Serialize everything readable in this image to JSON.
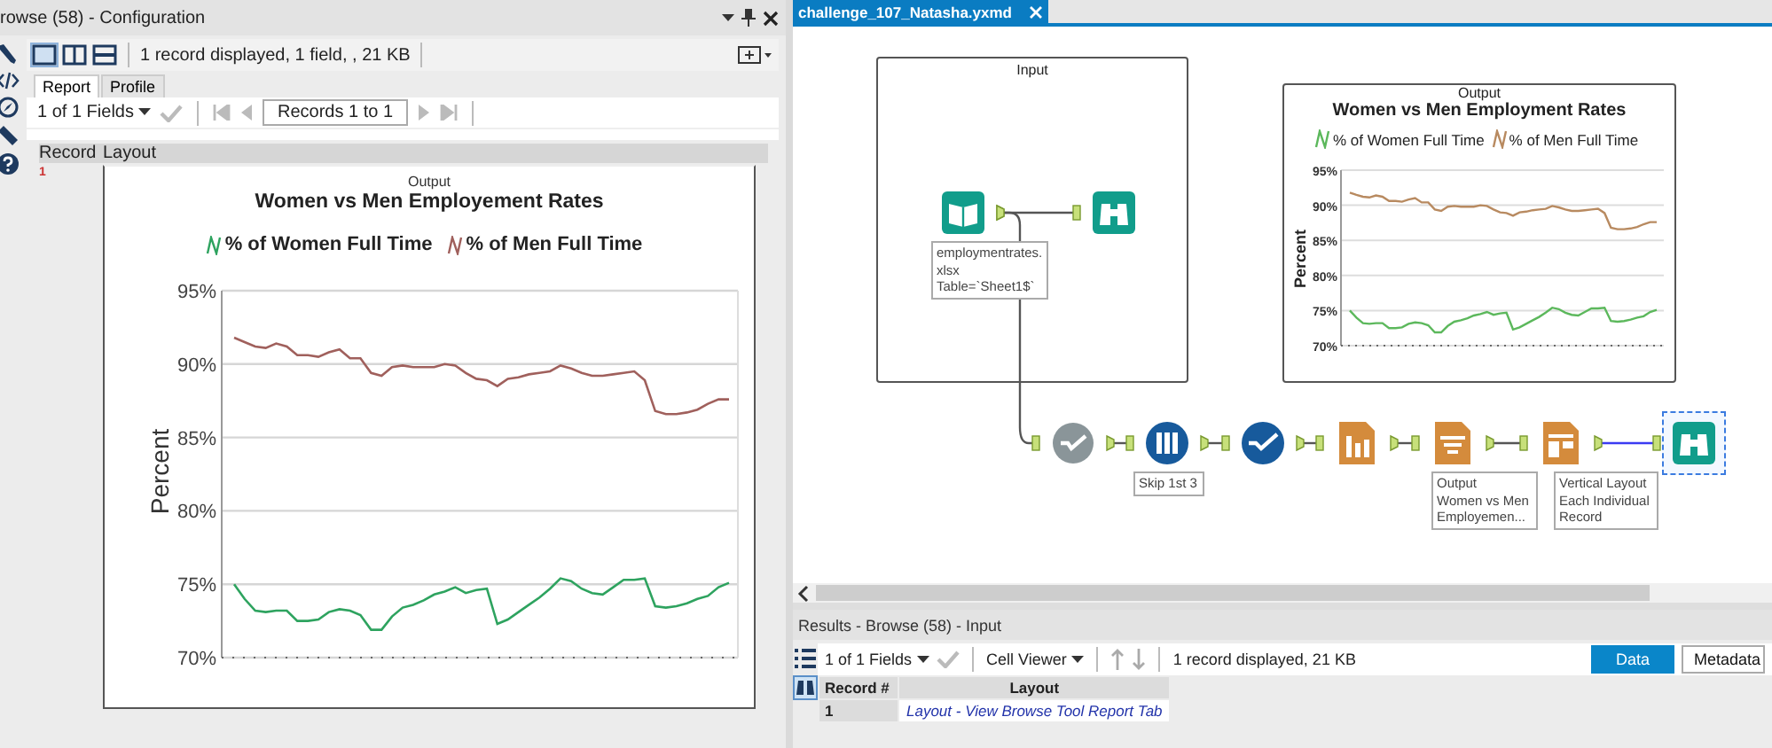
{
  "config_panel": {
    "title": "rowse (58) - Configuration",
    "status": "1 record displayed, 1 field, , 21 KB",
    "tabs": [
      {
        "label": "Report",
        "selected": true
      },
      {
        "label": "Profile",
        "selected": false
      }
    ],
    "fields_selector": "1 of 1 Fields",
    "records": "Records 1 to 1",
    "table": {
      "columns": [
        "Record",
        "Layout"
      ],
      "rows": [
        {
          "record": "1",
          "report": {
            "caption": "Output",
            "title": "Women vs Men Employement Rates",
            "chart_data": {
              "type": "line",
              "ylabel": "Percent",
              "ylim": [
                70,
                95
              ],
              "grid": true,
              "yticks": [
                {
                  "value": 70,
                  "label": "70%"
                },
                {
                  "value": 75,
                  "label": "75%"
                },
                {
                  "value": 80,
                  "label": "80%"
                },
                {
                  "value": 85,
                  "label": "85%"
                },
                {
                  "value": 90,
                  "label": "90%"
                },
                {
                  "value": 95,
                  "label": "95%"
                }
              ],
              "series": [
                {
                  "name": "% of Women Full Time",
                  "color": "#2ea35f",
                  "values": [
                    75.0,
                    74.0,
                    73.2,
                    73.1,
                    73.2,
                    73.2,
                    72.5,
                    72.5,
                    72.6,
                    73.1,
                    73.3,
                    73.2,
                    72.9,
                    71.9,
                    71.9,
                    72.8,
                    73.4,
                    73.6,
                    73.9,
                    74.3,
                    74.5,
                    74.8,
                    74.4,
                    74.6,
                    74.7,
                    72.3,
                    72.6,
                    73.1,
                    73.6,
                    74.1,
                    74.7,
                    75.4,
                    75.2,
                    74.7,
                    74.4,
                    74.3,
                    74.8,
                    75.3,
                    75.3,
                    75.4,
                    73.5,
                    73.4,
                    73.5,
                    73.7,
                    74.0,
                    74.2,
                    74.8,
                    75.1
                  ]
                },
                {
                  "name": "% of Men Full Time",
                  "color": "#a0605c",
                  "values": [
                    91.8,
                    91.5,
                    91.2,
                    91.1,
                    91.4,
                    91.2,
                    90.6,
                    90.6,
                    90.5,
                    90.8,
                    91.0,
                    90.4,
                    90.4,
                    89.4,
                    89.2,
                    89.8,
                    89.9,
                    89.8,
                    89.8,
                    89.8,
                    90.0,
                    89.9,
                    89.4,
                    89.0,
                    88.9,
                    88.5,
                    89.0,
                    89.1,
                    89.3,
                    89.4,
                    89.5,
                    89.9,
                    89.7,
                    89.4,
                    89.2,
                    89.2,
                    89.3,
                    89.4,
                    89.5,
                    88.9,
                    86.8,
                    86.6,
                    86.6,
                    86.7,
                    86.9,
                    87.3,
                    87.6,
                    87.6
                  ]
                }
              ]
            }
          }
        }
      ]
    }
  },
  "workflow": {
    "tab": {
      "label": "challenge_107_Natasha.yxmd",
      "selected": true
    },
    "containers": [
      {
        "title": "Input"
      },
      {
        "title": "Output",
        "report": {
          "title": "Women vs Men Employment Rates",
          "chart_data": {
            "type": "line",
            "ylabel": "Percent",
            "ylim": [
              70,
              95
            ],
            "grid": true,
            "yticks": [
              {
                "value": 70,
                "label": "70%"
              },
              {
                "value": 75,
                "label": "75%"
              },
              {
                "value": 80,
                "label": "80%"
              },
              {
                "value": 85,
                "label": "85%"
              },
              {
                "value": 90,
                "label": "90%"
              },
              {
                "value": 95,
                "label": "95%"
              }
            ],
            "series": [
              {
                "name": "% of Women Full Time",
                "color": "#5cb85c",
                "values": [
                  75.0,
                  74.0,
                  73.2,
                  73.1,
                  73.2,
                  73.2,
                  72.5,
                  72.5,
                  72.6,
                  73.1,
                  73.3,
                  73.2,
                  72.9,
                  71.9,
                  71.9,
                  72.8,
                  73.4,
                  73.6,
                  73.9,
                  74.3,
                  74.5,
                  74.8,
                  74.4,
                  74.6,
                  74.7,
                  72.3,
                  72.6,
                  73.1,
                  73.6,
                  74.1,
                  74.7,
                  75.4,
                  75.2,
                  74.7,
                  74.4,
                  74.3,
                  74.8,
                  75.3,
                  75.3,
                  75.4,
                  73.5,
                  73.4,
                  73.5,
                  73.7,
                  74.0,
                  74.2,
                  74.8,
                  75.1
                ]
              },
              {
                "name": "% of Men Full Time",
                "color": "#b88a60",
                "values": [
                  91.8,
                  91.5,
                  91.2,
                  91.1,
                  91.4,
                  91.2,
                  90.6,
                  90.6,
                  90.5,
                  90.8,
                  91.0,
                  90.4,
                  90.4,
                  89.4,
                  89.2,
                  89.8,
                  89.9,
                  89.8,
                  89.8,
                  89.8,
                  90.0,
                  89.9,
                  89.4,
                  89.0,
                  88.9,
                  88.5,
                  89.0,
                  89.1,
                  89.3,
                  89.4,
                  89.5,
                  89.9,
                  89.7,
                  89.4,
                  89.2,
                  89.2,
                  89.3,
                  89.4,
                  89.5,
                  88.9,
                  86.8,
                  86.6,
                  86.6,
                  86.7,
                  86.9,
                  87.3,
                  87.6,
                  87.6
                ]
              }
            ]
          }
        }
      }
    ],
    "tools": [
      {
        "kind": "book",
        "selected": false,
        "annotation": [
          "employmentrates.",
          "xlsx",
          "Table=`Sheet1$`"
        ]
      },
      {
        "kind": "binoculars",
        "selected": false
      },
      {
        "kind": "badge-check",
        "selected": false
      },
      {
        "kind": "tubes",
        "selected": false,
        "annotation": [
          "Skip 1st 3"
        ]
      },
      {
        "kind": "circle-check",
        "selected": false
      },
      {
        "kind": "bar-chart",
        "selected": false
      },
      {
        "kind": "report",
        "selected": false,
        "annotation": [
          "Output",
          "Women vs Men",
          "Employemen..."
        ]
      },
      {
        "kind": "layout",
        "selected": false,
        "annotation": [
          "Vertical Layout",
          "Each Individual",
          "Record"
        ]
      },
      {
        "kind": "binoculars",
        "selected": true
      }
    ]
  },
  "results": {
    "title": "Results - Browse (58) - Input",
    "fields_selector": "1 of 1 Fields",
    "viewer": "Cell Viewer",
    "status": "1 record displayed, 21 KB",
    "toggles": [
      {
        "label": "Data",
        "selected": true
      },
      {
        "label": "Metadata",
        "selected": false
      }
    ],
    "table": {
      "columns": [
        "Record #",
        "Layout"
      ],
      "rows": [
        [
          "1",
          "Layout - View Browse Tool Report Tab"
        ]
      ]
    }
  }
}
